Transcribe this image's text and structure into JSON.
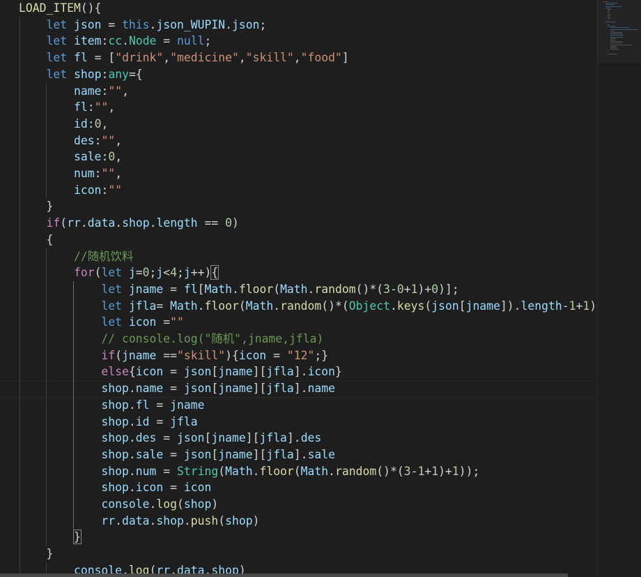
{
  "editor": {
    "lines": [
      [
        {
          "t": "LOAD_ITEM",
          "c": "fn"
        },
        {
          "t": "(){",
          "c": "op"
        }
      ],
      [
        {
          "t": "    "
        },
        {
          "t": "let",
          "c": "kw"
        },
        {
          "t": " "
        },
        {
          "t": "json",
          "c": "var"
        },
        {
          "t": " = ",
          "c": "op"
        },
        {
          "t": "this",
          "c": "kw"
        },
        {
          "t": ".",
          "c": "op"
        },
        {
          "t": "json_WUPIN",
          "c": "var"
        },
        {
          "t": ".",
          "c": "op"
        },
        {
          "t": "json",
          "c": "var"
        },
        {
          "t": ";",
          "c": "op"
        }
      ],
      [
        {
          "t": "    "
        },
        {
          "t": "let",
          "c": "kw"
        },
        {
          "t": " "
        },
        {
          "t": "item",
          "c": "var"
        },
        {
          "t": ":",
          "c": "op"
        },
        {
          "t": "cc",
          "c": "type"
        },
        {
          "t": ".",
          "c": "op"
        },
        {
          "t": "Node",
          "c": "type"
        },
        {
          "t": " = ",
          "c": "op"
        },
        {
          "t": "null",
          "c": "kw"
        },
        {
          "t": ";",
          "c": "op"
        }
      ],
      [
        {
          "t": "    "
        },
        {
          "t": "let",
          "c": "kw"
        },
        {
          "t": " "
        },
        {
          "t": "fl",
          "c": "var"
        },
        {
          "t": " = [",
          "c": "op"
        },
        {
          "t": "\"drink\"",
          "c": "str"
        },
        {
          "t": ",",
          "c": "op"
        },
        {
          "t": "\"medicine\"",
          "c": "str"
        },
        {
          "t": ",",
          "c": "op"
        },
        {
          "t": "\"skill\"",
          "c": "str"
        },
        {
          "t": ",",
          "c": "op"
        },
        {
          "t": "\"food\"",
          "c": "str"
        },
        {
          "t": "]",
          "c": "op"
        }
      ],
      [
        {
          "t": "    "
        },
        {
          "t": "let",
          "c": "kw"
        },
        {
          "t": " "
        },
        {
          "t": "shop",
          "c": "var"
        },
        {
          "t": ":",
          "c": "op"
        },
        {
          "t": "any",
          "c": "type"
        },
        {
          "t": "={",
          "c": "op"
        }
      ],
      [
        {
          "t": "        "
        },
        {
          "t": "name",
          "c": "var"
        },
        {
          "t": ":",
          "c": "op"
        },
        {
          "t": "\"\"",
          "c": "str"
        },
        {
          "t": ",",
          "c": "op"
        }
      ],
      [
        {
          "t": "        "
        },
        {
          "t": "fl",
          "c": "var"
        },
        {
          "t": ":",
          "c": "op"
        },
        {
          "t": "\"\"",
          "c": "str"
        },
        {
          "t": ",",
          "c": "op"
        }
      ],
      [
        {
          "t": "        "
        },
        {
          "t": "id",
          "c": "var"
        },
        {
          "t": ":",
          "c": "op"
        },
        {
          "t": "0",
          "c": "num"
        },
        {
          "t": ",",
          "c": "op"
        }
      ],
      [
        {
          "t": "        "
        },
        {
          "t": "des",
          "c": "var"
        },
        {
          "t": ":",
          "c": "op"
        },
        {
          "t": "\"\"",
          "c": "str"
        },
        {
          "t": ",",
          "c": "op"
        }
      ],
      [
        {
          "t": "        "
        },
        {
          "t": "sale",
          "c": "var"
        },
        {
          "t": ":",
          "c": "op"
        },
        {
          "t": "0",
          "c": "num"
        },
        {
          "t": ",",
          "c": "op"
        }
      ],
      [
        {
          "t": "        "
        },
        {
          "t": "num",
          "c": "var"
        },
        {
          "t": ":",
          "c": "op"
        },
        {
          "t": "\"\"",
          "c": "str"
        },
        {
          "t": ",",
          "c": "op"
        }
      ],
      [
        {
          "t": "        "
        },
        {
          "t": "icon",
          "c": "var"
        },
        {
          "t": ":",
          "c": "op"
        },
        {
          "t": "\"\"",
          "c": "str"
        }
      ],
      [
        {
          "t": "    "
        },
        {
          "t": "}",
          "c": "op"
        }
      ],
      [
        {
          "t": "    "
        },
        {
          "t": "if",
          "c": "ctrl"
        },
        {
          "t": "(",
          "c": "op"
        },
        {
          "t": "rr",
          "c": "var"
        },
        {
          "t": ".",
          "c": "op"
        },
        {
          "t": "data",
          "c": "var"
        },
        {
          "t": ".",
          "c": "op"
        },
        {
          "t": "shop",
          "c": "var"
        },
        {
          "t": ".",
          "c": "op"
        },
        {
          "t": "length",
          "c": "var"
        },
        {
          "t": " == ",
          "c": "op"
        },
        {
          "t": "0",
          "c": "num"
        },
        {
          "t": ")",
          "c": "op"
        }
      ],
      [
        {
          "t": "    "
        },
        {
          "t": "{",
          "c": "op"
        }
      ],
      [
        {
          "t": "        "
        },
        {
          "t": "//随机饮料",
          "c": "cmt"
        }
      ],
      [
        {
          "t": "        "
        },
        {
          "t": "for",
          "c": "ctrl"
        },
        {
          "t": "(",
          "c": "op"
        },
        {
          "t": "let",
          "c": "kw"
        },
        {
          "t": " "
        },
        {
          "t": "j",
          "c": "var"
        },
        {
          "t": "=",
          "c": "op"
        },
        {
          "t": "0",
          "c": "num"
        },
        {
          "t": ";",
          "c": "op"
        },
        {
          "t": "j",
          "c": "var"
        },
        {
          "t": "<",
          "c": "op"
        },
        {
          "t": "4",
          "c": "num"
        },
        {
          "t": ";",
          "c": "op"
        },
        {
          "t": "j",
          "c": "var"
        },
        {
          "t": "++)",
          "c": "op"
        },
        {
          "t": "{",
          "c": "op",
          "bm": true
        }
      ],
      [
        {
          "t": "            "
        },
        {
          "t": "let",
          "c": "kw"
        },
        {
          "t": " "
        },
        {
          "t": "jname",
          "c": "var"
        },
        {
          "t": " = ",
          "c": "op"
        },
        {
          "t": "fl",
          "c": "var"
        },
        {
          "t": "[",
          "c": "op"
        },
        {
          "t": "Math",
          "c": "var"
        },
        {
          "t": ".",
          "c": "op"
        },
        {
          "t": "floor",
          "c": "fn"
        },
        {
          "t": "(",
          "c": "op"
        },
        {
          "t": "Math",
          "c": "var"
        },
        {
          "t": ".",
          "c": "op"
        },
        {
          "t": "random",
          "c": "fn"
        },
        {
          "t": "()*(",
          "c": "op"
        },
        {
          "t": "3",
          "c": "num"
        },
        {
          "t": "-",
          "c": "op"
        },
        {
          "t": "0",
          "c": "num"
        },
        {
          "t": "+",
          "c": "op"
        },
        {
          "t": "1",
          "c": "num"
        },
        {
          "t": ")+",
          "c": "op"
        },
        {
          "t": "0",
          "c": "num"
        },
        {
          "t": ")];",
          "c": "op"
        }
      ],
      [
        {
          "t": "            "
        },
        {
          "t": "let",
          "c": "kw"
        },
        {
          "t": " "
        },
        {
          "t": "jfla",
          "c": "var"
        },
        {
          "t": "= ",
          "c": "op"
        },
        {
          "t": "Math",
          "c": "var"
        },
        {
          "t": ".",
          "c": "op"
        },
        {
          "t": "floor",
          "c": "fn"
        },
        {
          "t": "(",
          "c": "op"
        },
        {
          "t": "Math",
          "c": "var"
        },
        {
          "t": ".",
          "c": "op"
        },
        {
          "t": "random",
          "c": "fn"
        },
        {
          "t": "()*(",
          "c": "op"
        },
        {
          "t": "Object",
          "c": "type"
        },
        {
          "t": ".",
          "c": "op"
        },
        {
          "t": "keys",
          "c": "fn"
        },
        {
          "t": "(",
          "c": "op"
        },
        {
          "t": "json",
          "c": "var"
        },
        {
          "t": "[",
          "c": "op"
        },
        {
          "t": "jname",
          "c": "var"
        },
        {
          "t": "]).",
          "c": "op"
        },
        {
          "t": "length",
          "c": "var"
        },
        {
          "t": "-",
          "c": "op"
        },
        {
          "t": "1",
          "c": "num"
        },
        {
          "t": "+",
          "c": "op"
        },
        {
          "t": "1",
          "c": "num"
        },
        {
          "t": ")+",
          "c": "op"
        },
        {
          "t": "1",
          "c": "num"
        },
        {
          "t": ")",
          "c": "op"
        }
      ],
      [
        {
          "t": "            "
        },
        {
          "t": "let",
          "c": "kw"
        },
        {
          "t": " "
        },
        {
          "t": "icon",
          "c": "var"
        },
        {
          "t": " =",
          "c": "op"
        },
        {
          "t": "\"\"",
          "c": "str"
        }
      ],
      [
        {
          "t": "            "
        },
        {
          "t": "// console.log(\"随机\",jname,jfla)",
          "c": "cmt"
        }
      ],
      [
        {
          "t": "            "
        },
        {
          "t": "if",
          "c": "ctrl"
        },
        {
          "t": "(",
          "c": "op"
        },
        {
          "t": "jname",
          "c": "var"
        },
        {
          "t": " ==",
          "c": "op"
        },
        {
          "t": "\"skill\"",
          "c": "str"
        },
        {
          "t": "){",
          "c": "op"
        },
        {
          "t": "icon",
          "c": "var"
        },
        {
          "t": " = ",
          "c": "op"
        },
        {
          "t": "\"12\"",
          "c": "str"
        },
        {
          "t": ";}",
          "c": "op"
        }
      ],
      [
        {
          "t": "            "
        },
        {
          "t": "else",
          "c": "ctrl"
        },
        {
          "t": "{",
          "c": "op"
        },
        {
          "t": "icon",
          "c": "var"
        },
        {
          "t": " = ",
          "c": "op"
        },
        {
          "t": "json",
          "c": "var"
        },
        {
          "t": "[",
          "c": "op"
        },
        {
          "t": "jname",
          "c": "var"
        },
        {
          "t": "][",
          "c": "op"
        },
        {
          "t": "jfla",
          "c": "var"
        },
        {
          "t": "].",
          "c": "op"
        },
        {
          "t": "icon",
          "c": "var"
        },
        {
          "t": "}",
          "c": "op"
        }
      ],
      [
        {
          "t": "            "
        },
        {
          "t": "shop",
          "c": "var"
        },
        {
          "t": ".",
          "c": "op"
        },
        {
          "t": "name",
          "c": "var"
        },
        {
          "t": " = ",
          "c": "op"
        },
        {
          "t": "json",
          "c": "var"
        },
        {
          "t": "[",
          "c": "op"
        },
        {
          "t": "jname",
          "c": "var"
        },
        {
          "t": "][",
          "c": "op"
        },
        {
          "t": "jfla",
          "c": "var"
        },
        {
          "t": "].",
          "c": "op"
        },
        {
          "t": "name",
          "c": "var"
        }
      ],
      [
        {
          "t": "            "
        },
        {
          "t": "shop",
          "c": "var"
        },
        {
          "t": ".",
          "c": "op"
        },
        {
          "t": "fl",
          "c": "var"
        },
        {
          "t": " = ",
          "c": "op"
        },
        {
          "t": "jname",
          "c": "var"
        }
      ],
      [
        {
          "t": "            "
        },
        {
          "t": "shop",
          "c": "var"
        },
        {
          "t": ".",
          "c": "op"
        },
        {
          "t": "id",
          "c": "var"
        },
        {
          "t": " = ",
          "c": "op"
        },
        {
          "t": "jfla",
          "c": "var"
        }
      ],
      [
        {
          "t": "            "
        },
        {
          "t": "shop",
          "c": "var"
        },
        {
          "t": ".",
          "c": "op"
        },
        {
          "t": "des",
          "c": "var"
        },
        {
          "t": " = ",
          "c": "op"
        },
        {
          "t": "json",
          "c": "var"
        },
        {
          "t": "[",
          "c": "op"
        },
        {
          "t": "jname",
          "c": "var"
        },
        {
          "t": "][",
          "c": "op"
        },
        {
          "t": "jfla",
          "c": "var"
        },
        {
          "t": "].",
          "c": "op"
        },
        {
          "t": "des",
          "c": "var"
        }
      ],
      [
        {
          "t": "            "
        },
        {
          "t": "shop",
          "c": "var"
        },
        {
          "t": ".",
          "c": "op"
        },
        {
          "t": "sale",
          "c": "var"
        },
        {
          "t": " = ",
          "c": "op"
        },
        {
          "t": "json",
          "c": "var"
        },
        {
          "t": "[",
          "c": "op"
        },
        {
          "t": "jname",
          "c": "var"
        },
        {
          "t": "][",
          "c": "op"
        },
        {
          "t": "jfla",
          "c": "var"
        },
        {
          "t": "].",
          "c": "op"
        },
        {
          "t": "sale",
          "c": "var"
        }
      ],
      [
        {
          "t": "            "
        },
        {
          "t": "shop",
          "c": "var"
        },
        {
          "t": ".",
          "c": "op"
        },
        {
          "t": "num",
          "c": "var"
        },
        {
          "t": " = ",
          "c": "op"
        },
        {
          "t": "String",
          "c": "type"
        },
        {
          "t": "(",
          "c": "op"
        },
        {
          "t": "Math",
          "c": "var"
        },
        {
          "t": ".",
          "c": "op"
        },
        {
          "t": "floor",
          "c": "fn"
        },
        {
          "t": "(",
          "c": "op"
        },
        {
          "t": "Math",
          "c": "var"
        },
        {
          "t": ".",
          "c": "op"
        },
        {
          "t": "random",
          "c": "fn"
        },
        {
          "t": "()*(",
          "c": "op"
        },
        {
          "t": "3",
          "c": "num"
        },
        {
          "t": "-",
          "c": "op"
        },
        {
          "t": "1",
          "c": "num"
        },
        {
          "t": "+",
          "c": "op"
        },
        {
          "t": "1",
          "c": "num"
        },
        {
          "t": ")+",
          "c": "op"
        },
        {
          "t": "1",
          "c": "num"
        },
        {
          "t": "));",
          "c": "op"
        }
      ],
      [
        {
          "t": "            "
        },
        {
          "t": "shop",
          "c": "var"
        },
        {
          "t": ".",
          "c": "op"
        },
        {
          "t": "icon",
          "c": "var"
        },
        {
          "t": " = ",
          "c": "op"
        },
        {
          "t": "icon",
          "c": "var"
        }
      ],
      [
        {
          "t": "            "
        },
        {
          "t": "console",
          "c": "var"
        },
        {
          "t": ".",
          "c": "op"
        },
        {
          "t": "log",
          "c": "fn"
        },
        {
          "t": "(",
          "c": "op"
        },
        {
          "t": "shop",
          "c": "var"
        },
        {
          "t": ")",
          "c": "op"
        }
      ],
      [
        {
          "t": "            "
        },
        {
          "t": "rr",
          "c": "var"
        },
        {
          "t": ".",
          "c": "op"
        },
        {
          "t": "data",
          "c": "var"
        },
        {
          "t": ".",
          "c": "op"
        },
        {
          "t": "shop",
          "c": "var"
        },
        {
          "t": ".",
          "c": "op"
        },
        {
          "t": "push",
          "c": "fn"
        },
        {
          "t": "(",
          "c": "op"
        },
        {
          "t": "shop",
          "c": "var"
        },
        {
          "t": ")",
          "c": "op"
        }
      ],
      [
        {
          "t": "        "
        },
        {
          "t": "}",
          "c": "op",
          "bm": true
        }
      ],
      [
        {
          "t": "    "
        },
        {
          "t": "}",
          "c": "op"
        }
      ],
      [
        {
          "t": "        "
        },
        {
          "t": "console",
          "c": "var"
        },
        {
          "t": ".",
          "c": "op"
        },
        {
          "t": "log",
          "c": "fn"
        },
        {
          "t": "(",
          "c": "op"
        },
        {
          "t": "rr",
          "c": "var"
        },
        {
          "t": ".",
          "c": "op"
        },
        {
          "t": "data",
          "c": "var"
        },
        {
          "t": ".",
          "c": "op"
        },
        {
          "t": "shop",
          "c": "var"
        },
        {
          "t": ")",
          "c": "op"
        }
      ]
    ]
  }
}
